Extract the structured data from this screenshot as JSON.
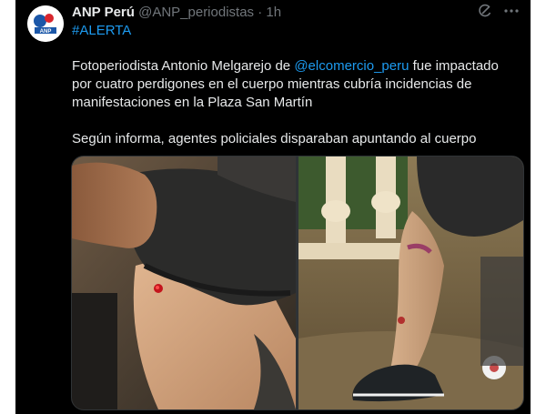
{
  "tweet": {
    "display_name": "ANP Perú",
    "handle": "@ANP_periodistas",
    "separator": "·",
    "time": "1h",
    "hashtag": "#ALERTA",
    "text_before_mention": "Fotoperiodista Antonio Melgarejo de ",
    "mention": "@elcomercio_peru",
    "text_after_mention": " fue impactado por cuatro perdigones en el cuerpo mientras cubría incidencias de manifestaciones en la Plaza San Martín",
    "second_paragraph": "Según informa, agentes policiales disparaban apuntando al cuerpo",
    "avatar_text": "ANP",
    "icons": {
      "grok": "grok-icon",
      "more": "more-options-icon"
    },
    "media": [
      {
        "description": "torso-wound-photo"
      },
      {
        "description": "leg-wound-photo"
      }
    ]
  },
  "colors": {
    "background": "#000000",
    "text": "#e7e9ea",
    "secondary_text": "#71767b",
    "link": "#1d9bf0"
  }
}
